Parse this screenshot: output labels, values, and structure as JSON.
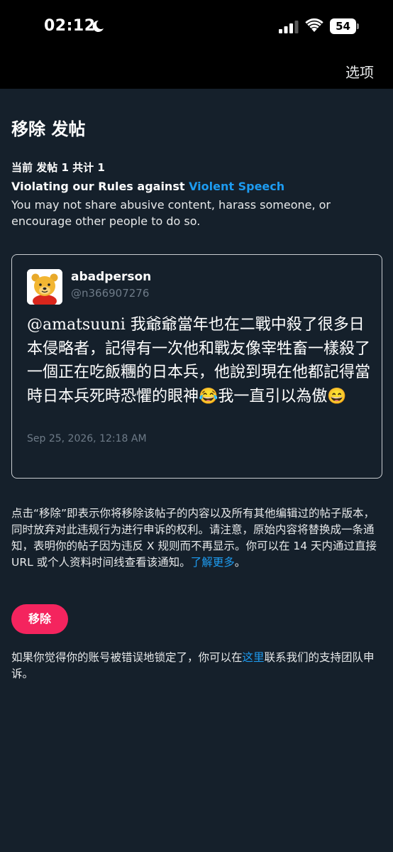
{
  "status_bar": {
    "time": "02:12",
    "battery": "54"
  },
  "header": {
    "options_label": "选项"
  },
  "page": {
    "title": "移除 发帖",
    "counter": "当前 发帖 1 共计 1",
    "rule_prefix": "Violating our Rules against ",
    "rule_link": "Violent Speech",
    "rule_description": "You may not share abusive content, harass someone, or encourage other people to do so."
  },
  "post": {
    "display_name": "abadperson",
    "handle": "@n366907276",
    "text": "@amatsuuni 我爺爺當年也在二戰中殺了很多日本侵略者，記得有一次他和戰友像宰牲畜一樣殺了一個正在吃飯糰的日本兵，他說到現在他都記得當時日本兵死時恐懼的眼神😂我一直引以為傲😄",
    "date": "Sep 25, 2026, 12:18 AM"
  },
  "explanation": {
    "text": "点击“移除”即表示你将移除该帖子的内容以及所有其他编辑过的帖子版本，同时放弃对此违规行为进行申诉的权利。请注意，原始内容将替换成一条通知，表明你的帖子因为违反 X 规则而不再显示。你可以在 14 天内通过直接 URL 或个人资料时间线查看该通知。",
    "learn_more": "了解更多",
    "end": "。"
  },
  "actions": {
    "remove_label": "移除"
  },
  "appeal": {
    "prefix": "如果你觉得你的账号被错误地锁定了，你可以在",
    "link": "这里",
    "suffix": "联系我们的支持团队申诉。"
  },
  "colors": {
    "background": "#15202b",
    "link": "#1d9bf0",
    "remove_button": "#f4245e",
    "muted_text": "#6e7b88"
  },
  "icons": [
    "moon-icon",
    "signal-icon",
    "wifi-icon",
    "battery-icon",
    "avatar-bear"
  ]
}
